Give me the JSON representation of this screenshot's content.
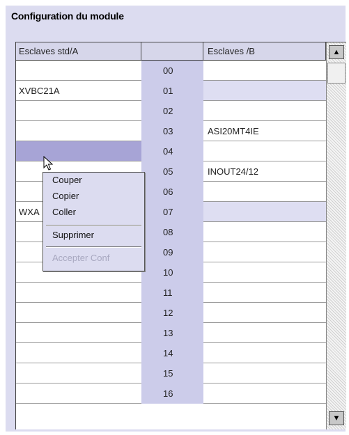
{
  "title": "Configuration du module",
  "headers": {
    "col_a": "Esclaves std/A",
    "col_num": "",
    "col_b": "Esclaves /B"
  },
  "rows": [
    {
      "a": "",
      "num": "00",
      "b": ""
    },
    {
      "a": "XVBC21A",
      "num": "01",
      "b": ""
    },
    {
      "a": "",
      "num": "02",
      "b": ""
    },
    {
      "a": "",
      "num": "03",
      "b": "ASI20MT4IE"
    },
    {
      "a": "",
      "num": "04",
      "b": ""
    },
    {
      "a": "",
      "num": "05",
      "b": "INOUT24/12"
    },
    {
      "a": "",
      "num": "06",
      "b": ""
    },
    {
      "a": "WXA",
      "num": "07",
      "b": ""
    },
    {
      "a": "",
      "num": "08",
      "b": ""
    },
    {
      "a": "",
      "num": "09",
      "b": ""
    },
    {
      "a": "",
      "num": "10",
      "b": ""
    },
    {
      "a": "",
      "num": "11",
      "b": ""
    },
    {
      "a": "",
      "num": "12",
      "b": ""
    },
    {
      "a": "",
      "num": "13",
      "b": ""
    },
    {
      "a": "",
      "num": "14",
      "b": ""
    },
    {
      "a": "",
      "num": "15",
      "b": ""
    },
    {
      "a": "",
      "num": "16",
      "b": ""
    }
  ],
  "context_menu": {
    "cut": "Couper",
    "copy": "Copier",
    "paste": "Coller",
    "delete": "Supprimer",
    "accept": "Accepter Conf"
  },
  "scrollbar": {
    "up_icon": "arrow-up-icon",
    "down_icon": "arrow-down-icon"
  },
  "colors": {
    "panel": "#dcdcf0",
    "number_column": "#ccccea",
    "selected_cell": "#a7a4d6",
    "highlight_cell": "#dedef2"
  },
  "selection": {
    "selected_row": "04",
    "highlighted_b_rows": [
      "01",
      "07"
    ]
  }
}
